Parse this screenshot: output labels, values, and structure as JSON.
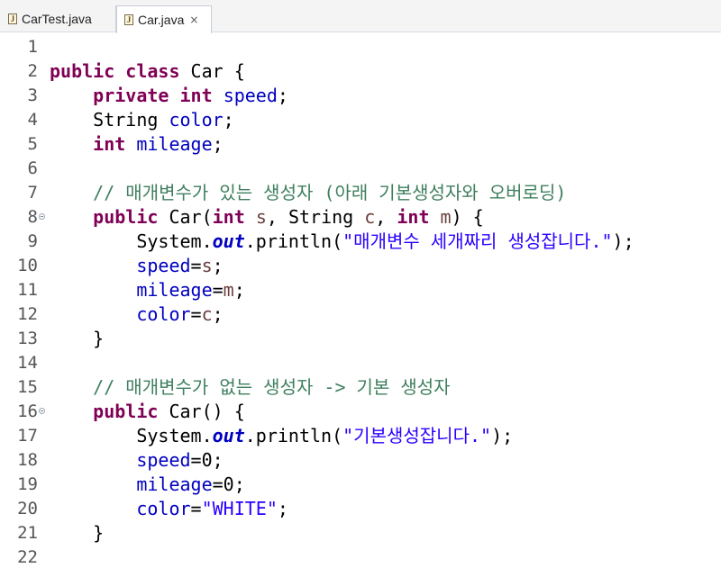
{
  "tabs": [
    {
      "label": "CarTest.java",
      "active": false,
      "icon": "java-file-icon"
    },
    {
      "label": "Car.java",
      "active": true,
      "icon": "java-file-icon",
      "close": "×"
    }
  ],
  "editor": {
    "file": "Car.java",
    "line_numbers": [
      "1",
      "2",
      "3",
      "4",
      "5",
      "6",
      "7",
      "8",
      "9",
      "10",
      "11",
      "12",
      "13",
      "14",
      "15",
      "16",
      "17",
      "18",
      "19",
      "20",
      "21",
      "22"
    ],
    "lines": [
      {
        "tokens": []
      },
      {
        "tokens": [
          [
            "kw",
            "public"
          ],
          [
            "p",
            " "
          ],
          [
            "kw",
            "class"
          ],
          [
            "p",
            " Car {"
          ]
        ]
      },
      {
        "tokens": [
          [
            "p",
            "    "
          ],
          [
            "kw",
            "private"
          ],
          [
            "p",
            " "
          ],
          [
            "kw",
            "int"
          ],
          [
            "p",
            " "
          ],
          [
            "fld",
            "speed"
          ],
          [
            "p",
            ";"
          ]
        ]
      },
      {
        "tokens": [
          [
            "p",
            "    String "
          ],
          [
            "fld",
            "color"
          ],
          [
            "p",
            ";"
          ]
        ]
      },
      {
        "tokens": [
          [
            "p",
            "    "
          ],
          [
            "kw",
            "int"
          ],
          [
            "p",
            " "
          ],
          [
            "fld",
            "mileage"
          ],
          [
            "p",
            ";"
          ]
        ]
      },
      {
        "tokens": []
      },
      {
        "tokens": [
          [
            "p",
            "    "
          ],
          [
            "cmt",
            "// 매개변수가 있는 생성자 (아래 기본생성자와 오버로딩)"
          ]
        ]
      },
      {
        "tokens": [
          [
            "p",
            "    "
          ],
          [
            "kw",
            "public"
          ],
          [
            "p",
            " Car("
          ],
          [
            "kw",
            "int"
          ],
          [
            "p",
            " "
          ],
          [
            "var",
            "s"
          ],
          [
            "p",
            ", String "
          ],
          [
            "var",
            "c"
          ],
          [
            "p",
            ", "
          ],
          [
            "kw",
            "int"
          ],
          [
            "p",
            " "
          ],
          [
            "var",
            "m"
          ],
          [
            "p",
            ") {"
          ]
        ],
        "fold": true
      },
      {
        "tokens": [
          [
            "p",
            "        System."
          ],
          [
            "sfld",
            "out"
          ],
          [
            "p",
            ".println("
          ],
          [
            "str",
            "\"매개변수 세개짜리 생성잡니다.\""
          ],
          [
            "p",
            ");"
          ]
        ]
      },
      {
        "tokens": [
          [
            "p",
            "        "
          ],
          [
            "fld",
            "speed"
          ],
          [
            "p",
            "="
          ],
          [
            "var",
            "s"
          ],
          [
            "p",
            ";"
          ]
        ]
      },
      {
        "tokens": [
          [
            "p",
            "        "
          ],
          [
            "fld",
            "mileage"
          ],
          [
            "p",
            "="
          ],
          [
            "var",
            "m"
          ],
          [
            "p",
            ";"
          ]
        ]
      },
      {
        "tokens": [
          [
            "p",
            "        "
          ],
          [
            "fld",
            "color"
          ],
          [
            "p",
            "="
          ],
          [
            "var",
            "c"
          ],
          [
            "p",
            ";"
          ]
        ]
      },
      {
        "tokens": [
          [
            "p",
            "    }"
          ]
        ]
      },
      {
        "tokens": []
      },
      {
        "tokens": [
          [
            "p",
            "    "
          ],
          [
            "cmt",
            "// 매개변수가 없는 생성자 -> 기본 생성자"
          ]
        ]
      },
      {
        "tokens": [
          [
            "p",
            "    "
          ],
          [
            "kw",
            "public"
          ],
          [
            "p",
            " Car() {"
          ]
        ],
        "fold": true
      },
      {
        "tokens": [
          [
            "p",
            "        System."
          ],
          [
            "sfld",
            "out"
          ],
          [
            "p",
            ".println("
          ],
          [
            "str",
            "\"기본생성잡니다.\""
          ],
          [
            "p",
            ");"
          ]
        ]
      },
      {
        "tokens": [
          [
            "p",
            "        "
          ],
          [
            "fld",
            "speed"
          ],
          [
            "p",
            "=0;"
          ]
        ]
      },
      {
        "tokens": [
          [
            "p",
            "        "
          ],
          [
            "fld",
            "mileage"
          ],
          [
            "p",
            "=0;"
          ]
        ]
      },
      {
        "tokens": [
          [
            "p",
            "        "
          ],
          [
            "fld",
            "color"
          ],
          [
            "p",
            "="
          ],
          [
            "str",
            "\"WHITE\""
          ],
          [
            "p",
            ";"
          ]
        ]
      },
      {
        "tokens": [
          [
            "p",
            "    }"
          ]
        ]
      },
      {
        "tokens": []
      }
    ]
  },
  "colors": {
    "keyword": "#7f0055",
    "field": "#0000c0",
    "local_variable": "#6a3e3e",
    "string": "#2a00ff",
    "comment": "#3f7f5f"
  }
}
